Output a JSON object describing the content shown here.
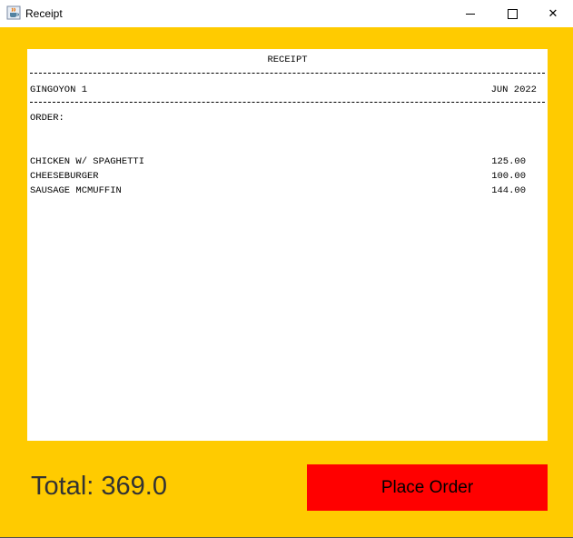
{
  "window": {
    "title": "Receipt",
    "icon": "java-cup-icon",
    "minimize_icon": "minimize-icon",
    "maximize_icon": "maximize-icon",
    "close_glyph": "✕"
  },
  "colors": {
    "background": "#ffcb00",
    "button": "#ff0000",
    "receipt_paper": "#ffffff"
  },
  "receipt": {
    "title": "RECEIPT",
    "store": "GINGOYON 1",
    "date": "JUN 2022",
    "order_label": "ORDER:",
    "items": [
      {
        "name": "CHICKEN W/ SPAGHETTI",
        "price": "125.00"
      },
      {
        "name": "CHEESEBURGER",
        "price": "100.00"
      },
      {
        "name": "SAUSAGE MCMUFFIN",
        "price": "144.00"
      }
    ]
  },
  "footer": {
    "total_text": "Total: 369.0",
    "place_order_label": "Place Order"
  }
}
